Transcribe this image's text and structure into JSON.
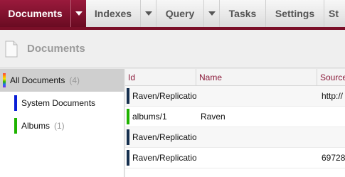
{
  "nav": {
    "items": [
      {
        "label": "Documents",
        "active": true,
        "dropdown": true
      },
      {
        "label": "Indexes",
        "active": false,
        "dropdown": true
      },
      {
        "label": "Query",
        "active": false,
        "dropdown": true
      },
      {
        "label": "Tasks",
        "active": false,
        "dropdown": false
      },
      {
        "label": "Settings",
        "active": false,
        "dropdown": false
      },
      {
        "label": "St",
        "active": false,
        "dropdown": false
      }
    ]
  },
  "header": {
    "title": "Documents",
    "icon": "document-icon"
  },
  "sidebar": {
    "items": [
      {
        "label": "All Documents",
        "count": "(4)",
        "color": "rainbow",
        "selected": true
      },
      {
        "label": "System Documents",
        "count": "",
        "color": "#0a1fd6",
        "selected": false
      },
      {
        "label": "Albums",
        "count": "(1)",
        "color": "#1fb300",
        "selected": false
      }
    ]
  },
  "table": {
    "columns": [
      "Id",
      "Name",
      "Source"
    ],
    "rows": [
      {
        "id": "Raven/Replication",
        "name": "",
        "source": "http://",
        "color": "#16304f"
      },
      {
        "id": "albums/1",
        "name": "Raven",
        "source": "",
        "color": "#1fb300"
      },
      {
        "id": "Raven/Replication",
        "name": "",
        "source": "",
        "color": "#16304f"
      },
      {
        "id": "Raven/Replication",
        "name": "",
        "source": "69728",
        "color": "#16304f"
      }
    ]
  }
}
